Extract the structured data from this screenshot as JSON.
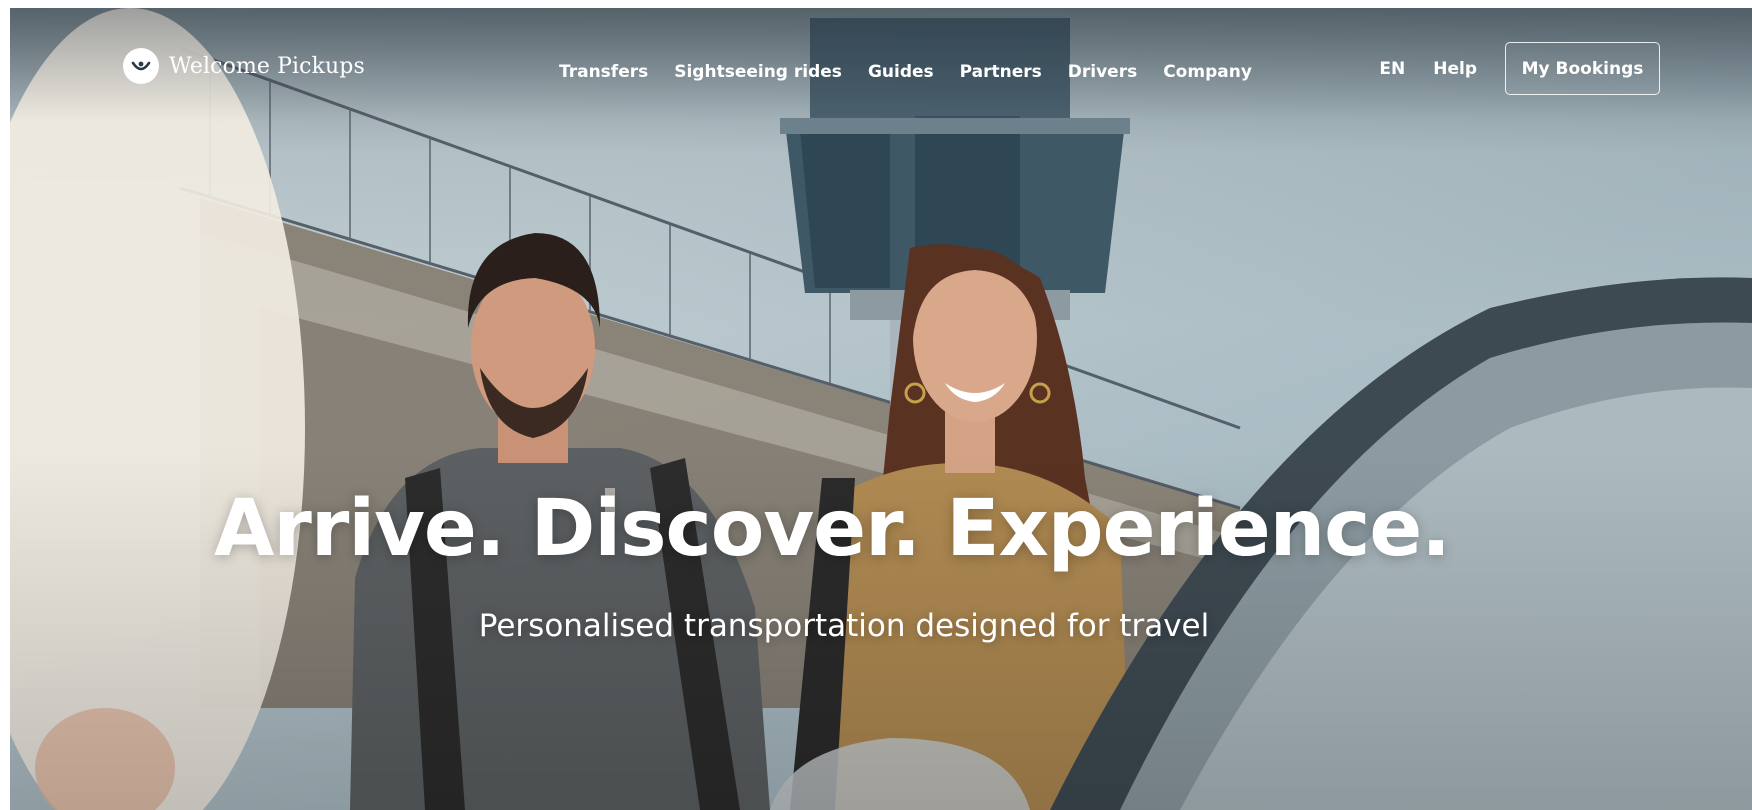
{
  "header": {
    "brand_name": "Welcome Pickups",
    "nav": [
      {
        "label": "Transfers"
      },
      {
        "label": "Sightseeing rides"
      },
      {
        "label": "Guides"
      },
      {
        "label": "Partners"
      },
      {
        "label": "Drivers"
      },
      {
        "label": "Company"
      }
    ],
    "language": "EN",
    "help": "Help",
    "bookings_button": "My Bookings"
  },
  "hero": {
    "title": "Arrive. Discover. Experience.",
    "subtitle": "Personalised transportation designed for travel"
  },
  "colors": {
    "text": "#ffffff",
    "sky": "#bfcdd2",
    "tower": "#4d6470"
  }
}
